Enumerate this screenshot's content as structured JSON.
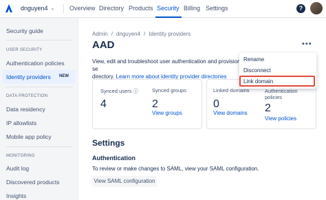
{
  "topnav": {
    "org_name": "dnguyen4",
    "items": [
      "Overview",
      "Directory",
      "Products",
      "Security",
      "Billing",
      "Settings"
    ],
    "active": "Security",
    "help_glyph": "?"
  },
  "sidebar": {
    "security_guide": "Security guide",
    "sections": [
      {
        "title": "USER SECURITY",
        "items": [
          "Authentication policies",
          "Identity providers"
        ]
      },
      {
        "title": "DATA PROTECTION",
        "items": [
          "Data residency",
          "IP allowlists",
          "Mobile app policy"
        ]
      },
      {
        "title": "MONITORING",
        "items": [
          "Audit log",
          "Discovered products",
          "Insights"
        ]
      }
    ],
    "active_item": "Identity providers",
    "new_badge": "NEW"
  },
  "breadcrumb": [
    "Admin",
    "/",
    "dnguyen4",
    "/",
    "Identity providers"
  ],
  "page_title": "AAD",
  "more_glyph": "•••",
  "description": {
    "text": "View, edit and troubleshoot user authentication and provisioning se",
    "text2": "directory.",
    "link": "Learn more about identity provider directories"
  },
  "stats": [
    {
      "label": "Synced users",
      "info_glyph": "ⓘ",
      "value": "4",
      "link": ""
    },
    {
      "label": "Synced groups",
      "value": "2",
      "link": "View groups"
    },
    {
      "label": "Linked domains",
      "value": "0",
      "link": "View domains"
    },
    {
      "label": "Authentication",
      "label2": "policies",
      "value": "2",
      "link": "View policies"
    }
  ],
  "settings": {
    "title": "Settings",
    "auth_title": "Authentication",
    "auth_desc": "To review or make changes to SAML, view your SAML configuration.",
    "saml_button": "View SAML configuration"
  },
  "dropdown": {
    "items": [
      "Rename",
      "Disconnect",
      "Link domain"
    ],
    "highlighted": "Link domain"
  },
  "colors": {
    "accent": "#0052cc",
    "highlight_border": "#e2483d",
    "sidebar_bg": "#f4f5f7"
  }
}
